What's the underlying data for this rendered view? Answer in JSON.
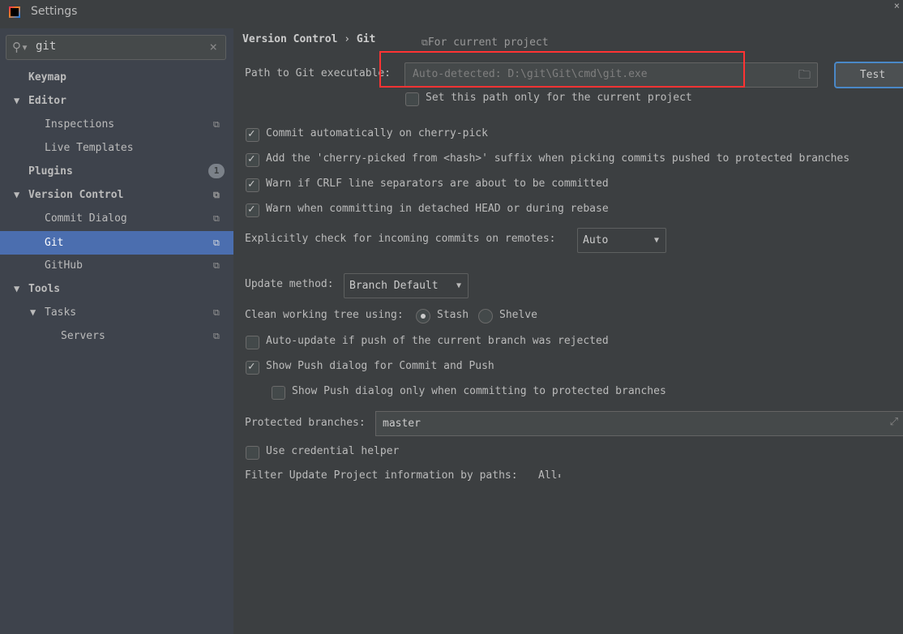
{
  "window": {
    "title": "Settings",
    "close_icon": "×"
  },
  "search": {
    "value": "git"
  },
  "sidebar": {
    "items": [
      {
        "label": "Keymap"
      },
      {
        "label": "Editor"
      },
      {
        "label": "Inspections"
      },
      {
        "label": "Live Templates"
      },
      {
        "label": "Plugins",
        "badge": "1"
      },
      {
        "label": "Version Control"
      },
      {
        "label": "Commit Dialog"
      },
      {
        "label": "Git"
      },
      {
        "label": "GitHub"
      },
      {
        "label": "Tools"
      },
      {
        "label": "Tasks"
      },
      {
        "label": "Servers"
      }
    ]
  },
  "breadcrumb": {
    "parent": "Version Control",
    "sep": "›",
    "current": "Git",
    "scope": "For current project"
  },
  "git": {
    "path_label": "Path to Git executable:",
    "path_placeholder": "Auto-detected: D:\\git\\Git\\cmd\\git.exe",
    "test_label": "Test",
    "path_only_project": "Set this path only for the current project",
    "commit_auto": "Commit automatically on cherry-pick",
    "cherry_suffix": "Add the 'cherry-picked from <hash>' suffix when picking commits pushed to protected branches",
    "warn_crlf": "Warn if CRLF line separators are about to be committed",
    "warn_detached": "Warn when committing in detached HEAD or during rebase",
    "incoming_label": "Explicitly check for incoming commits on remotes:",
    "incoming_value": "Auto",
    "update_label": "Update method:",
    "update_value": "Branch Default",
    "clean_label": "Clean working tree using:",
    "stash": "Stash",
    "shelve": "Shelve",
    "auto_update": "Auto-update if push of the current branch was rejected",
    "show_push": "Show Push dialog for Commit and Push",
    "show_push_protected": "Show Push dialog only when committing to protected branches",
    "protected_label": "Protected branches:",
    "protected_value": "master",
    "credential": "Use credential helper",
    "filter_label": "Filter Update Project information by paths:",
    "filter_value": "All"
  },
  "colors": {
    "selection": "#4b6eaf",
    "highlight": "#ff3333",
    "accent": "#4a88c7"
  }
}
